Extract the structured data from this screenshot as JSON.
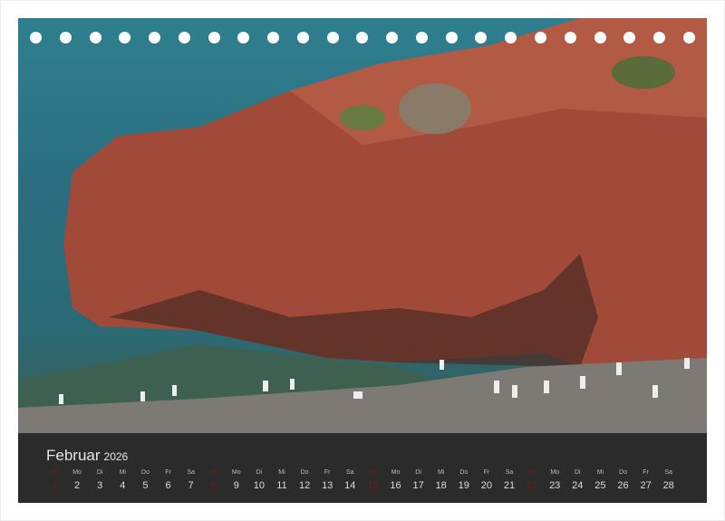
{
  "calendar": {
    "month": "Februar",
    "year": "2026",
    "days": [
      {
        "n": "So",
        "d": "1",
        "sun": true
      },
      {
        "n": "Mo",
        "d": "2"
      },
      {
        "n": "Di",
        "d": "3"
      },
      {
        "n": "Mi",
        "d": "4"
      },
      {
        "n": "Do",
        "d": "5"
      },
      {
        "n": "Fr",
        "d": "6"
      },
      {
        "n": "Sa",
        "d": "7"
      },
      {
        "n": "So",
        "d": "8",
        "sun": true
      },
      {
        "n": "Mo",
        "d": "9"
      },
      {
        "n": "Di",
        "d": "10"
      },
      {
        "n": "Mi",
        "d": "11"
      },
      {
        "n": "Do",
        "d": "12"
      },
      {
        "n": "Fr",
        "d": "13"
      },
      {
        "n": "Sa",
        "d": "14"
      },
      {
        "n": "So",
        "d": "15",
        "sun": true
      },
      {
        "n": "Mo",
        "d": "16"
      },
      {
        "n": "Di",
        "d": "17"
      },
      {
        "n": "Mi",
        "d": "18"
      },
      {
        "n": "Do",
        "d": "19"
      },
      {
        "n": "Fr",
        "d": "20"
      },
      {
        "n": "Sa",
        "d": "21"
      },
      {
        "n": "So",
        "d": "22",
        "sun": true
      },
      {
        "n": "Mo",
        "d": "23"
      },
      {
        "n": "Di",
        "d": "24"
      },
      {
        "n": "Mi",
        "d": "25"
      },
      {
        "n": "Do",
        "d": "26"
      },
      {
        "n": "Fr",
        "d": "27"
      },
      {
        "n": "Sa",
        "d": "28"
      }
    ]
  },
  "colors": {
    "strip": "#2b2b2b",
    "sunday": "#6e1d1d",
    "rock": "#a0473a",
    "sea": "#2f7f8f"
  }
}
